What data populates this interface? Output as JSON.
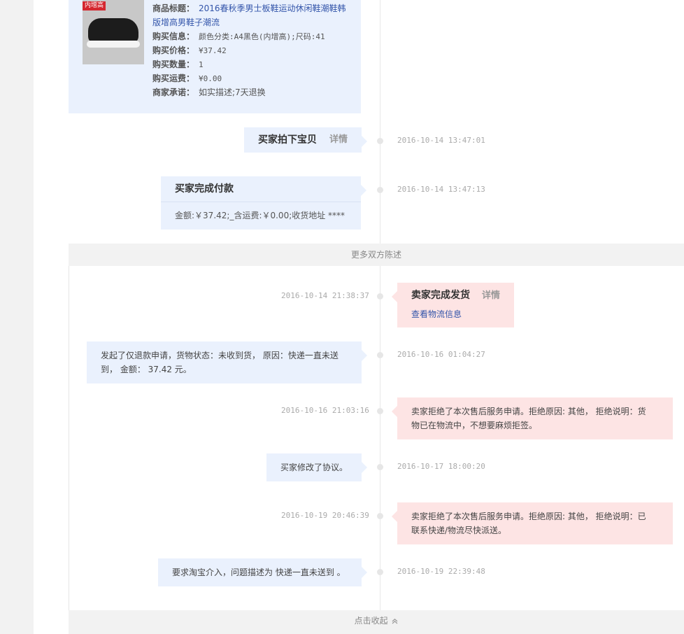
{
  "order": {
    "image_tag": "内增高",
    "title_label": "商品标题：",
    "title_line1": "2016春秋季男士板鞋运动休闲鞋潮鞋韩",
    "title_line2": "版增高男鞋子潮流",
    "info_label": "购买信息：",
    "info_value": "颜色分类:A4黑色(内增高);尺码:41",
    "price_label": "购买价格：",
    "price_value": "¥37.42",
    "qty_label": "购买数量：",
    "qty_value": "1",
    "shipping_label": "购买运费：",
    "shipping_value": "¥0.00",
    "promise_label": "商家承诺：",
    "promise_value": "如实描述;7天退换"
  },
  "events": {
    "e1": {
      "title": "买家拍下宝贝",
      "link": "详情",
      "time": "2016-10-14 13:47:01"
    },
    "e2": {
      "title": "买家完成付款",
      "body": "金额:￥37.42;_含运费:￥0.00;收货地址 ****",
      "time": "2016-10-14 13:47:13"
    },
    "e3": {
      "title": "卖家完成发货",
      "link": "详情",
      "sublink": "查看物流信息",
      "time": "2016-10-14 21:38:37"
    },
    "e4": {
      "line1": "发起了仅退款申请，货物状态：未收到货，  原因：快递一直未送",
      "line2": "到，  金额：  37.42 元。",
      "time": "2016-10-16 01:04:27"
    },
    "e5": {
      "line1": "卖家拒绝了本次售后服务申请。拒绝原因: 其他，  拒绝说明：货",
      "line2": "物已在物流中，不想要麻烦拒签。",
      "time": "2016-10-16 21:03:16"
    },
    "e6": {
      "text": "买家修改了协议。",
      "time": "2016-10-17 18:00:20"
    },
    "e7": {
      "line1": "卖家拒绝了本次售后服务申请。拒绝原因: 其他，  拒绝说明：已",
      "line2": "联系快递/物流尽快派送。",
      "time": "2016-10-19 20:46:39"
    },
    "e8": {
      "text": "要求淘宝介入，问题描述为 快递一直未送到 。",
      "time": "2016-10-19 22:39:48"
    }
  },
  "more_bar": "更多双方陈述",
  "collapse_bar": {
    "label": "点击收起",
    "icon": "double-chevron-up-icon"
  }
}
